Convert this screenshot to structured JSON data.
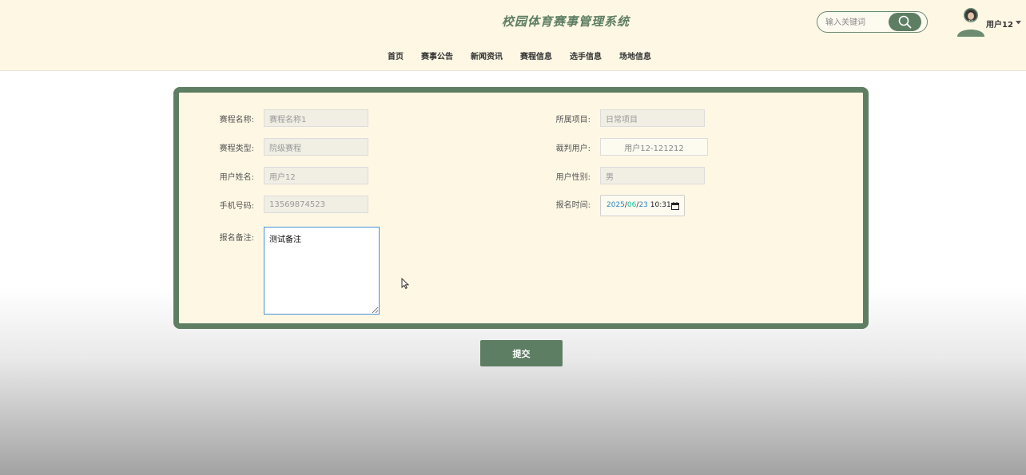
{
  "header": {
    "site_title": "校园体育赛事管理系统",
    "search_placeholder": "输入关键词",
    "username": "用户12"
  },
  "nav": [
    "首页",
    "赛事公告",
    "新闻资讯",
    "赛程信息",
    "选手信息",
    "场地信息"
  ],
  "form": {
    "left": [
      {
        "label": "赛程名称:",
        "value": "赛程名称1"
      },
      {
        "label": "赛程类型:",
        "value": "院级赛程"
      },
      {
        "label": "用户姓名:",
        "value": "用户12"
      },
      {
        "label": "手机号码:",
        "value": "13569874523"
      }
    ],
    "right": [
      {
        "label": "所属项目:",
        "value": "日常项目"
      },
      {
        "label": "裁判用户:",
        "value": "用户12-121212"
      },
      {
        "label": "用户性别:",
        "value": "男"
      }
    ],
    "datetime": {
      "label": "报名时间:",
      "year": "2025",
      "month": "06",
      "day": "23",
      "time": "10:31"
    },
    "note": {
      "label": "报名备注:",
      "value": "测试备注"
    }
  },
  "submit_label": "提交",
  "colors": {
    "accent": "#5e7e63",
    "header_bg": "#fdf7e4",
    "focus_border": "#4a90d9"
  }
}
